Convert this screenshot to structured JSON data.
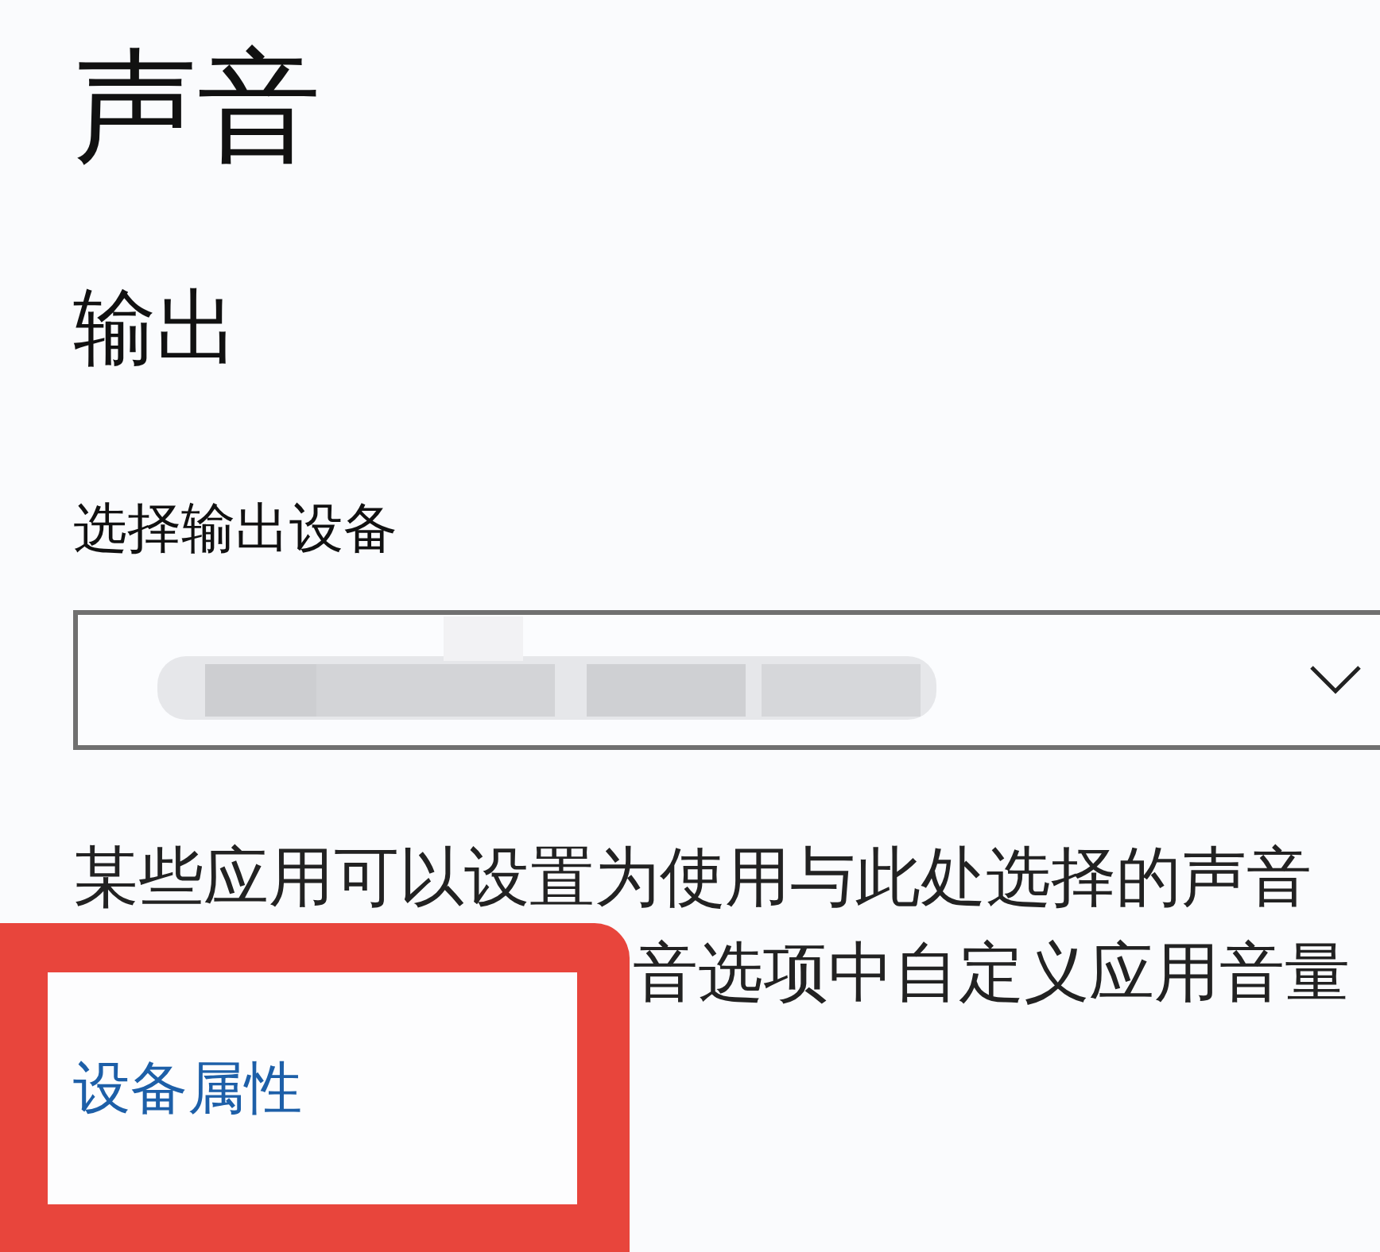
{
  "title": "声音",
  "section": "输出",
  "output_device": {
    "label": "选择输出设备",
    "expanded": false
  },
  "description": [
    "某些应用可以设置为使用与此处选择的声音",
    "音选项中自定义应用音量"
  ],
  "highlight": {
    "link": "设备属性"
  }
}
